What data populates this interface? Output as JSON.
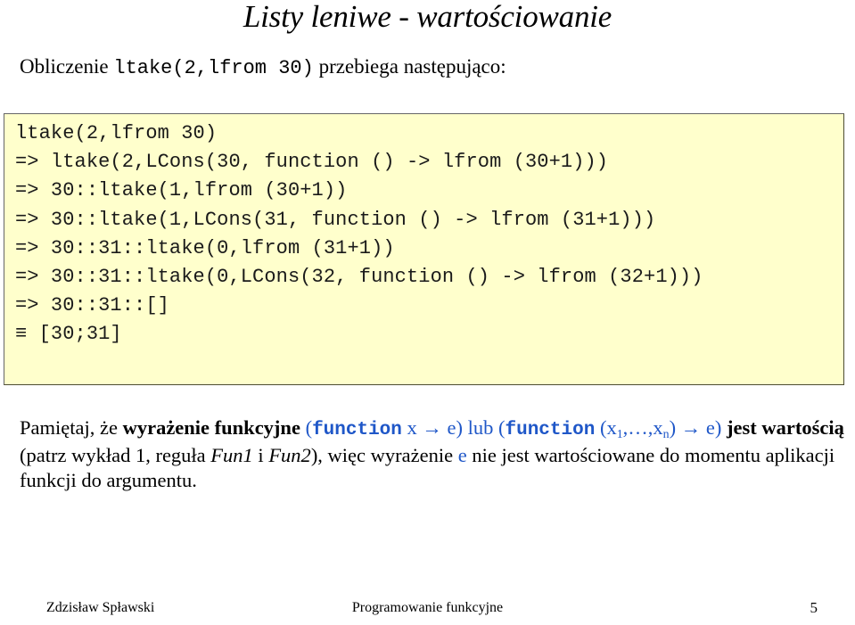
{
  "slide": {
    "title": "Listy leniwe - wartościowanie",
    "intro": {
      "before": "Obliczenie ",
      "code": "ltake(2,lfrom 30)",
      "after": " przebiega następująco:"
    },
    "code_block": {
      "background_color": "#FFFFCC",
      "border_color": "#666666",
      "lines": [
        "ltake(2,lfrom 30)",
        "=> ltake(2,LCons(30, function () -> lfrom (30+1)))",
        "=> 30::ltake(1,lfrom (30+1))",
        "=> 30::ltake(1,LCons(31, function () -> lfrom (31+1)))",
        "=> 30::31::ltake(0,lfrom (31+1))",
        "=> 30::31::ltake(0,LCons(32, function () -> lfrom (32+1)))",
        "=> 30::31::[]",
        "≡ [30;31]"
      ]
    },
    "note": {
      "accent_color": "#1F57C8",
      "s1": "Pamiętaj, że ",
      "s2_bold": "wyrażenie funkcyjne",
      "s3_blue": " (",
      "s4_blue_mono": "function",
      "s5_blue": " x → e) lub (",
      "s6_blue_mono": "function",
      "s7_blue": " (x",
      "s7_sub": "1",
      "s8_blue": ",…,x",
      "s8_sub": "n",
      "s9_blue": ") → e)",
      "s10": " ",
      "s11_bold": "jest wartością",
      "s12": " (patrz wykład 1, reguła ",
      "s13_italic": "Fun1",
      "s14": " i ",
      "s15_italic": "Fun2",
      "s16": "), więc wyrażenie ",
      "s17_blue": "e",
      "s18": " nie jest wartościowane do momentu aplikacji funkcji do argumentu."
    },
    "footer": {
      "author": "Zdzisław Spławski",
      "course": "Programowanie funkcyjne",
      "page": "5"
    }
  }
}
